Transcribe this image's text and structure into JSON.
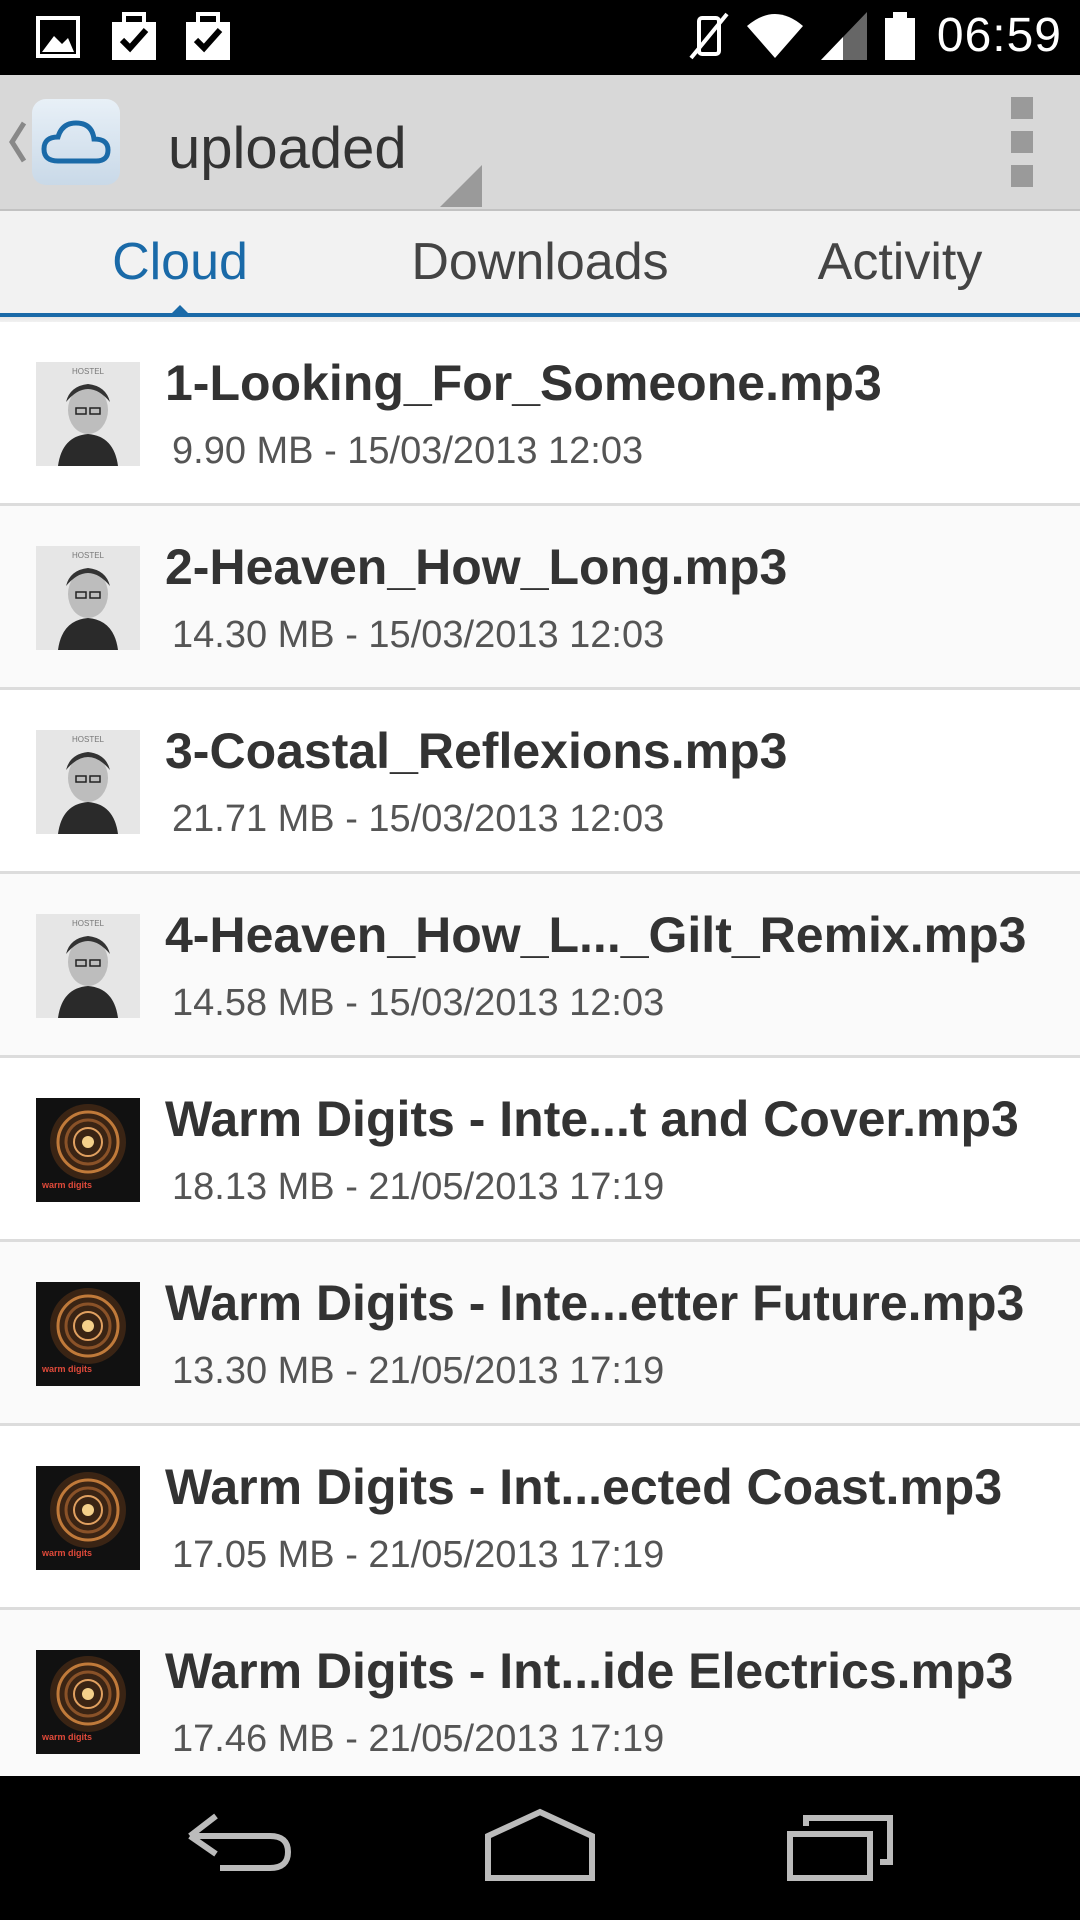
{
  "status_bar": {
    "time": "06:59",
    "icons": [
      "image-icon",
      "task-check-icon",
      "task-check-icon",
      "vibrate-off-icon",
      "wifi-icon",
      "signal-icon",
      "battery-icon"
    ]
  },
  "action_bar": {
    "title": "uploaded",
    "icons": [
      "up-caret-icon",
      "cloud-logo-icon",
      "spinner-arrow-icon",
      "overflow-menu-icon"
    ]
  },
  "tabs": [
    {
      "label": "Cloud",
      "active": true
    },
    {
      "label": "Downloads",
      "active": false
    },
    {
      "label": "Activity",
      "active": false
    }
  ],
  "files": [
    {
      "name": "1-Looking_For_Someone.mp3",
      "meta": "9.90 MB - 15/03/2013 12:03",
      "art": "hostel-cover",
      "art_text": "HOSTEL"
    },
    {
      "name": "2-Heaven_How_Long.mp3",
      "meta": "14.30 MB - 15/03/2013 12:03",
      "art": "hostel-cover",
      "art_text": "HOSTEL"
    },
    {
      "name": "3-Coastal_Reflexions.mp3",
      "meta": "21.71 MB - 15/03/2013 12:03",
      "art": "hostel-cover",
      "art_text": "HOSTEL"
    },
    {
      "name": "4-Heaven_How_L..._Gilt_Remix.mp3",
      "meta": "14.58 MB - 15/03/2013 12:03",
      "art": "hostel-cover",
      "art_text": "HOSTEL"
    },
    {
      "name": "Warm Digits - Inte...t and Cover.mp3",
      "meta": "18.13 MB - 21/05/2013 17:19",
      "art": "warm-digits-cover",
      "art_text": "warm digits"
    },
    {
      "name": "Warm Digits - Inte...etter Future.mp3",
      "meta": "13.30 MB - 21/05/2013 17:19",
      "art": "warm-digits-cover",
      "art_text": "warm digits"
    },
    {
      "name": "Warm Digits - Int...ected Coast.mp3",
      "meta": "17.05 MB - 21/05/2013 17:19",
      "art": "warm-digits-cover",
      "art_text": "warm digits"
    },
    {
      "name": "Warm Digits - Int...ide Electrics.mp3",
      "meta": "17.46 MB - 21/05/2013 17:19",
      "art": "warm-digits-cover",
      "art_text": "warm digits"
    }
  ],
  "nav_bar": {
    "icons": [
      "back-icon",
      "home-icon",
      "recent-apps-icon"
    ]
  },
  "colors": {
    "accent": "#1a6aa8",
    "action_bar": "#d8d8d8",
    "status_bar": "#000000"
  }
}
